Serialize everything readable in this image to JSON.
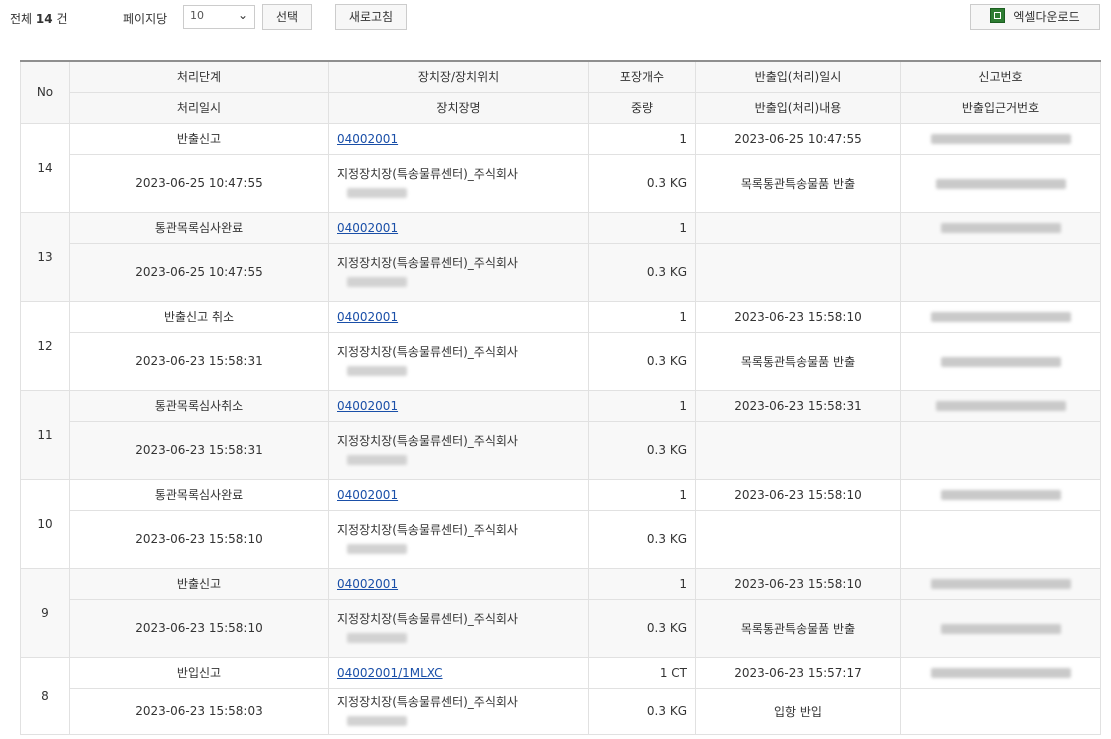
{
  "toolbar": {
    "total_prefix": "전체",
    "total_count": "14",
    "total_suffix": "건",
    "per_page_label": "페이지당",
    "per_page_value": "10",
    "select_button": "선택",
    "refresh_button": "새로고침",
    "excel_button": "엑셀다운로드"
  },
  "headers": {
    "no": "No",
    "top": [
      "처리단계",
      "장치장/장치위치",
      "포장개수",
      "반출입(처리)일시",
      "신고번호"
    ],
    "bottom": [
      "처리일시",
      "장치장명",
      "중량",
      "반출입(처리)내용",
      "반출입근거번호"
    ]
  },
  "rows": [
    {
      "no": "14",
      "stage": "반출신고",
      "location": "04002001",
      "count": "1",
      "io_datetime": "2023-06-25 10:47:55",
      "proc_datetime": "2023-06-25 10:47:55",
      "warehouse": "지정장치장(특송물류센터)_주식회사",
      "weight": "0.3 KG",
      "io_content": "목록통관특송물품 반출"
    },
    {
      "no": "13",
      "stage": "통관목록심사완료",
      "location": "04002001",
      "count": "1",
      "io_datetime": "",
      "proc_datetime": "2023-06-25 10:47:55",
      "warehouse": "지정장치장(특송물류센터)_주식회사",
      "weight": "0.3 KG",
      "io_content": ""
    },
    {
      "no": "12",
      "stage": "반출신고 취소",
      "location": "04002001",
      "count": "1",
      "io_datetime": "2023-06-23 15:58:10",
      "proc_datetime": "2023-06-23 15:58:31",
      "warehouse": "지정장치장(특송물류센터)_주식회사",
      "weight": "0.3 KG",
      "io_content": "목록통관특송물품 반출"
    },
    {
      "no": "11",
      "stage": "통관목록심사취소",
      "location": "04002001",
      "count": "1",
      "io_datetime": "2023-06-23 15:58:31",
      "proc_datetime": "2023-06-23 15:58:31",
      "warehouse": "지정장치장(특송물류센터)_주식회사",
      "weight": "0.3 KG",
      "io_content": ""
    },
    {
      "no": "10",
      "stage": "통관목록심사완료",
      "location": "04002001",
      "count": "1",
      "io_datetime": "2023-06-23 15:58:10",
      "proc_datetime": "2023-06-23 15:58:10",
      "warehouse": "지정장치장(특송물류센터)_주식회사",
      "weight": "0.3 KG",
      "io_content": ""
    },
    {
      "no": "9",
      "stage": "반출신고",
      "location": "04002001",
      "count": "1",
      "io_datetime": "2023-06-23 15:58:10",
      "proc_datetime": "2023-06-23 15:58:10",
      "warehouse": "지정장치장(특송물류센터)_주식회사",
      "weight": "0.3 KG",
      "io_content": "목록통관특송물품 반출"
    },
    {
      "no": "8",
      "stage": "반입신고",
      "location": "04002001/1MLXC",
      "count": "1 CT",
      "io_datetime": "2023-06-23 15:57:17",
      "proc_datetime": "2023-06-23 15:58:03",
      "warehouse": "지정장치장(특송물류센터)_주식회사",
      "weight": "0.3 KG",
      "io_content": "입항 반입"
    }
  ]
}
